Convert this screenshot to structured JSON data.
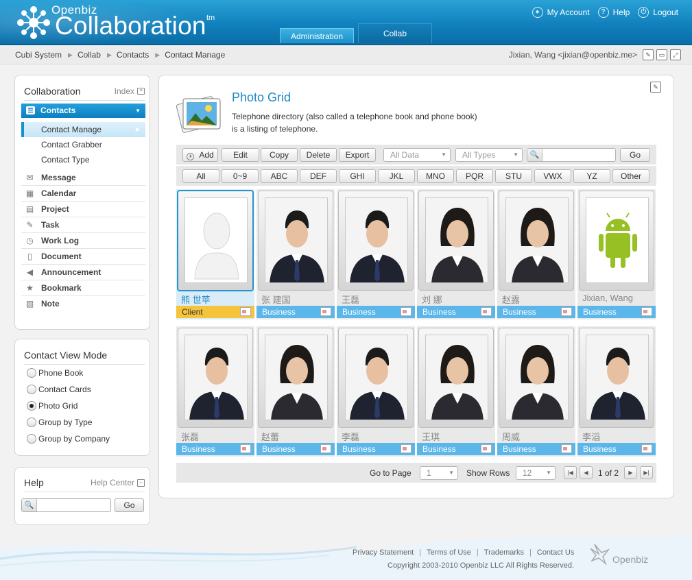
{
  "header": {
    "logo_small": "Openbiz",
    "logo_big": "Collaboration",
    "logo_tm": "tm",
    "links": [
      {
        "label": "My Account",
        "icon": "user-icon"
      },
      {
        "label": "Help",
        "icon": "help-icon"
      },
      {
        "label": "Logout",
        "icon": "power-icon"
      }
    ],
    "tabs": [
      {
        "label": "Administration",
        "active": false
      },
      {
        "label": "Collab",
        "active": true
      }
    ]
  },
  "breadcrumb": {
    "items": [
      "Cubi System",
      "Collab",
      "Contacts",
      "Contact Manage"
    ],
    "user": "Jixian, Wang <jixian@openbiz.me>"
  },
  "sidebar": {
    "title": "Collaboration",
    "index_label": "Index",
    "contacts_label": "Contacts",
    "sub_items": [
      {
        "label": "Contact Manage",
        "active": true
      },
      {
        "label": "Contact Grabber",
        "active": false
      },
      {
        "label": "Contact Type",
        "active": false
      }
    ],
    "nav_items": [
      {
        "label": "Message",
        "icon": "message-icon"
      },
      {
        "label": "Calendar",
        "icon": "calendar-icon"
      },
      {
        "label": "Project",
        "icon": "project-icon"
      },
      {
        "label": "Task",
        "icon": "task-icon"
      },
      {
        "label": "Work Log",
        "icon": "clock-icon"
      },
      {
        "label": "Document",
        "icon": "document-icon"
      },
      {
        "label": "Announcement",
        "icon": "speaker-icon"
      },
      {
        "label": "Bookmark",
        "icon": "star-icon"
      },
      {
        "label": "Note",
        "icon": "note-icon"
      }
    ]
  },
  "view_mode": {
    "title": "Contact View Mode",
    "options": [
      {
        "label": "Phone Book",
        "checked": false
      },
      {
        "label": "Contact Cards",
        "checked": false
      },
      {
        "label": "Photo Grid",
        "checked": true
      },
      {
        "label": "Group by Type",
        "checked": false
      },
      {
        "label": "Group by Company",
        "checked": false
      }
    ]
  },
  "help": {
    "title": "Help",
    "center_label": "Help Center",
    "search_value": "",
    "go_label": "Go"
  },
  "main": {
    "title": "Photo Grid",
    "description_line1": "Telephone directory (also called a telephone book and phone book)",
    "description_line2": "is a listing of telephone.",
    "toolbar": {
      "add": "Add",
      "edit": "Edit",
      "copy": "Copy",
      "delete": "Delete",
      "export": "Export",
      "filter_data": "All Data",
      "filter_types": "All Types",
      "search_value": "",
      "go": "Go"
    },
    "alpha": [
      "All",
      "0~9",
      "ABC",
      "DEF",
      "GHI",
      "JKL",
      "MNO",
      "PQR",
      "STU",
      "VWX",
      "YZ",
      "Other"
    ],
    "contacts": [
      {
        "name": "熊 世苹",
        "type": "Client",
        "photo": "placeholder",
        "selected": true
      },
      {
        "name": "张 建国",
        "type": "Business",
        "photo": "man",
        "selected": false
      },
      {
        "name": "王磊",
        "type": "Business",
        "photo": "man",
        "selected": false
      },
      {
        "name": "刘 娜",
        "type": "Business",
        "photo": "woman",
        "selected": false
      },
      {
        "name": "赵露",
        "type": "Business",
        "photo": "woman",
        "selected": false
      },
      {
        "name": "Jixian, Wang",
        "type": "Business",
        "photo": "android",
        "selected": false
      },
      {
        "name": "张磊",
        "type": "Business",
        "photo": "man",
        "selected": false
      },
      {
        "name": "赵蕾",
        "type": "Business",
        "photo": "woman",
        "selected": false
      },
      {
        "name": "李磊",
        "type": "Business",
        "photo": "man",
        "selected": false
      },
      {
        "name": "王琪",
        "type": "Business",
        "photo": "woman",
        "selected": false
      },
      {
        "name": "周威",
        "type": "Business",
        "photo": "woman",
        "selected": false
      },
      {
        "name": "李滔",
        "type": "Business",
        "photo": "man",
        "selected": false
      }
    ],
    "pager": {
      "goto_label": "Go to Page",
      "page_value": "1",
      "rows_label": "Show Rows",
      "rows_value": "12",
      "page_info": "1 of 2"
    }
  },
  "footer": {
    "links": [
      "Privacy Statement",
      "Terms of Use",
      "Trademarks",
      "Contact Us"
    ],
    "copyright": "Copyright 2003-2010 Openbiz LLC All Rights Reserved.",
    "logo": "Openbiz"
  },
  "colors": {
    "header_blue": "#1181bd",
    "accent_blue": "#1a8ac5",
    "business_tag": "#5bb6ea",
    "client_tag": "#f5c33c"
  }
}
